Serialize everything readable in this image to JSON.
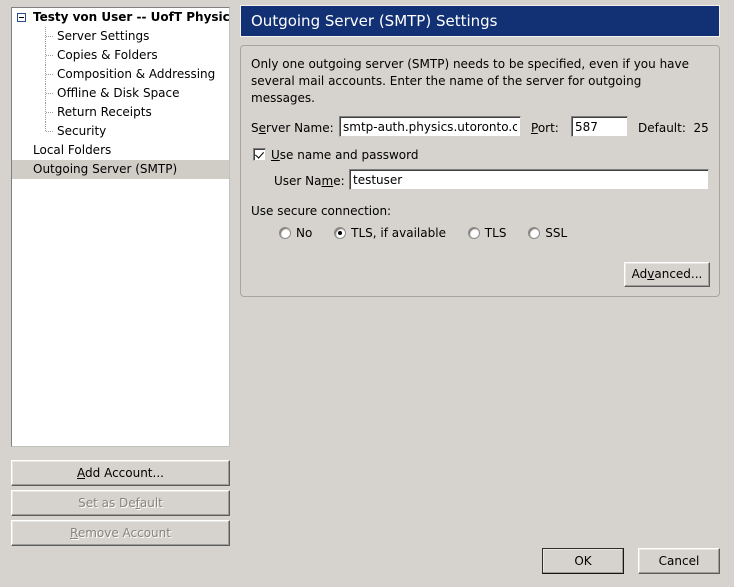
{
  "window": {
    "background_color": "#d6d3ce"
  },
  "account_tree": {
    "root": {
      "label": "Testy von User -- UofT Physics",
      "expander_state": "expanded",
      "children": [
        {
          "label": "Server Settings"
        },
        {
          "label": "Copies & Folders"
        },
        {
          "label": "Composition & Addressing"
        },
        {
          "label": "Offline & Disk Space"
        },
        {
          "label": "Return Receipts"
        },
        {
          "label": "Security"
        }
      ]
    },
    "local_folders": {
      "label": "Local Folders"
    },
    "outgoing_server": {
      "label": "Outgoing Server (SMTP)",
      "selected": true
    },
    "selection_color": "#d0cdc7"
  },
  "account_buttons": {
    "add_account": {
      "label": "Add Account...",
      "accel": "A",
      "enabled": true
    },
    "set_as_default": {
      "label": "Set as Default",
      "accel": "f",
      "enabled": false
    },
    "remove_account": {
      "label": "Remove Account",
      "accel": "R",
      "enabled": false
    }
  },
  "pane": {
    "title": "Outgoing Server (SMTP) Settings",
    "title_bar_color": "#123174",
    "title_text_color": "#ffffff"
  },
  "smtp": {
    "description": "Only one outgoing server (SMTP) needs to be specified, even if you have several mail accounts. Enter the name of the server for outgoing messages.",
    "server_name": {
      "label_before": "S",
      "label_accel": "e",
      "label_after": "rver Name:",
      "value": "smtp-auth.physics.utoronto.ca",
      "placeholder": ""
    },
    "port": {
      "label_before": "",
      "label_accel": "P",
      "label_after": "ort:",
      "value": "587",
      "placeholder": ""
    },
    "default_port": {
      "label": "Default:",
      "value": "25"
    },
    "use_name_and_password": {
      "label_before": "",
      "label_accel": "U",
      "label_after": "se name and password",
      "checked": true
    },
    "user_name": {
      "label_before": "User Na",
      "label_accel": "m",
      "label_after": "e:",
      "value": "testuser",
      "placeholder": ""
    },
    "secure_connection": {
      "label": "Use secure connection:",
      "options": [
        {
          "label": "No",
          "selected": false
        },
        {
          "label": "TLS, if available",
          "selected": true
        },
        {
          "label": "TLS",
          "selected": false
        },
        {
          "label": "SSL",
          "selected": false
        }
      ]
    },
    "advanced_button": {
      "label_before": "Ad",
      "label_accel": "v",
      "label_after": "anced..."
    }
  },
  "dialog_buttons": {
    "ok": {
      "label": "OK",
      "is_default": true
    },
    "cancel": {
      "label": "Cancel",
      "is_default": false
    }
  }
}
